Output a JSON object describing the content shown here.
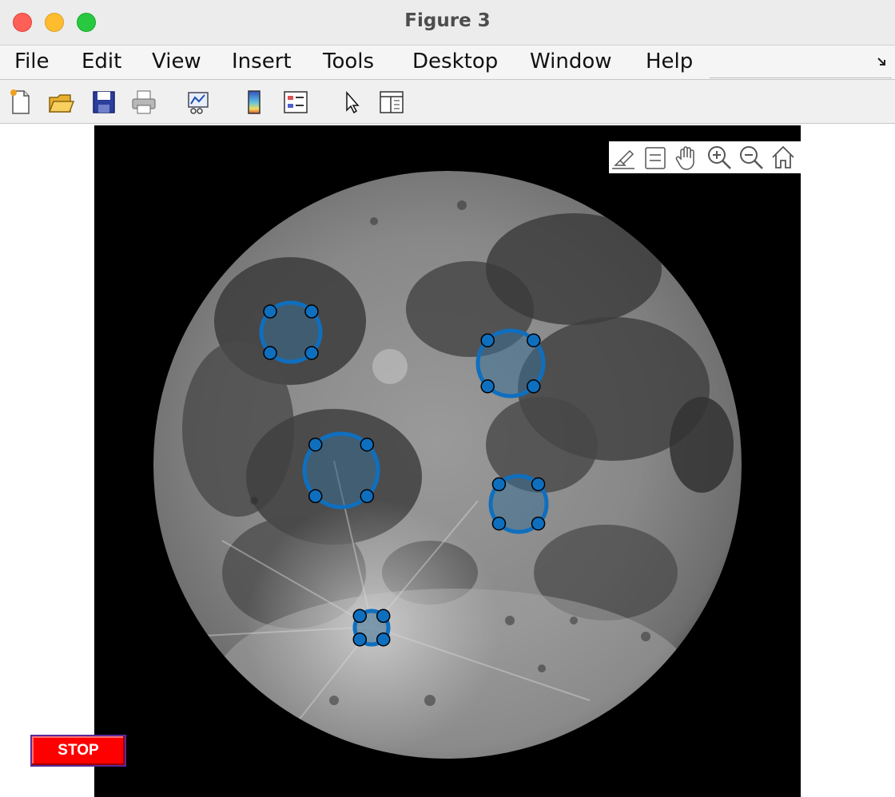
{
  "window": {
    "title": "Figure 3"
  },
  "menu": [
    {
      "name": "menu-file",
      "label": "File"
    },
    {
      "name": "menu-edit",
      "label": "Edit"
    },
    {
      "name": "menu-view",
      "label": "View"
    },
    {
      "name": "menu-insert",
      "label": "Insert"
    },
    {
      "name": "menu-tools",
      "label": "Tools"
    },
    {
      "name": "menu-desktop",
      "label": "Desktop"
    },
    {
      "name": "menu-window",
      "label": "Window"
    },
    {
      "name": "menu-help",
      "label": "Help"
    }
  ],
  "toolbar": {
    "icons": [
      "new-figure-icon",
      "open-file-icon",
      "save-icon",
      "print-icon",
      "link-plot-icon",
      "insert-colorbar-icon",
      "insert-legend-icon",
      "edit-plot-arrow-icon",
      "property-inspector-icon"
    ]
  },
  "axes_toolbar": {
    "icons": [
      "brush-icon",
      "data-tips-icon",
      "pan-hand-icon",
      "zoom-in-icon",
      "zoom-out-icon",
      "home-restore-icon"
    ]
  },
  "rois": [
    {
      "name": "roi-circle-1",
      "shape": "circle",
      "vertices": 4
    },
    {
      "name": "roi-circle-2",
      "shape": "circle",
      "vertices": 4
    },
    {
      "name": "roi-circle-3",
      "shape": "circle",
      "vertices": 4
    },
    {
      "name": "roi-circle-4",
      "shape": "circle",
      "vertices": 4
    },
    {
      "name": "roi-circle-5",
      "shape": "circle",
      "vertices": 4
    }
  ],
  "stop_button": {
    "label": "STOP"
  },
  "colors": {
    "roi_stroke": "#0f6fbf",
    "roi_fill": "#3a6e94",
    "stop_bg": "#ff0000",
    "axes_bg": "#000000"
  }
}
